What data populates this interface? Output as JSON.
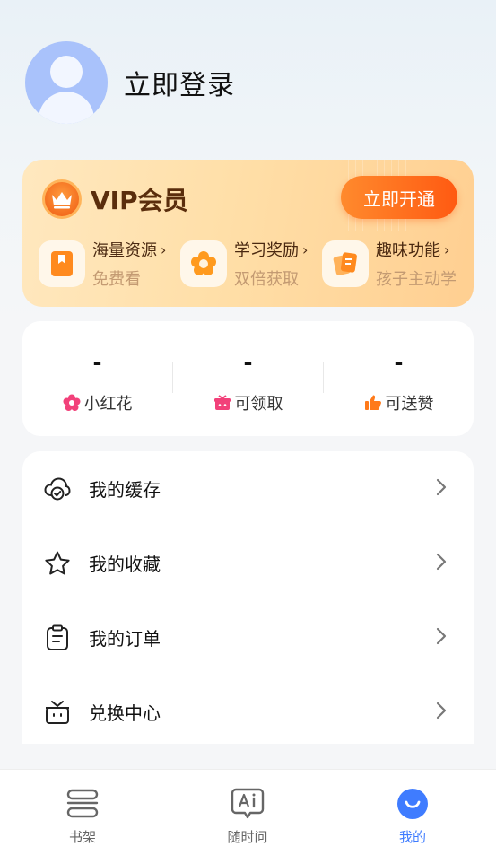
{
  "profile": {
    "login_text": "立即登录"
  },
  "vip": {
    "title": "VIP会员",
    "open_button": "立即开通",
    "benefits": [
      {
        "title": "海量资源",
        "subtitle": "免费看",
        "icon": "book-icon"
      },
      {
        "title": "学习奖励",
        "subtitle": "双倍获取",
        "icon": "flower-icon"
      },
      {
        "title": "趣味功能",
        "subtitle": "孩子主动学",
        "icon": "cards-icon"
      }
    ],
    "arrow": "›"
  },
  "stats": [
    {
      "value": "-",
      "label": "小红花",
      "icon": "flower-icon",
      "color": "#f2417a"
    },
    {
      "value": "-",
      "label": "可领取",
      "icon": "gift-icon",
      "color": "#f2417a"
    },
    {
      "value": "-",
      "label": "可送赞",
      "icon": "thumbs-up-icon",
      "color": "#ff7a1a"
    }
  ],
  "menu": [
    {
      "label": "我的缓存",
      "icon": "cloud-check-icon"
    },
    {
      "label": "我的收藏",
      "icon": "star-icon"
    },
    {
      "label": "我的订单",
      "icon": "clipboard-icon"
    },
    {
      "label": "兑换中心",
      "icon": "gift-box-icon"
    }
  ],
  "tabbar": [
    {
      "label": "书架",
      "icon": "bookshelf-icon",
      "active": false
    },
    {
      "label": "随时问",
      "icon": "ai-chat-icon",
      "active": false
    },
    {
      "label": "我的",
      "icon": "smile-profile-icon",
      "active": true
    }
  ],
  "colors": {
    "accent": "#3f7cff",
    "vip_orange": "#ff6a1a",
    "vip_brown": "#5a2d0c"
  }
}
